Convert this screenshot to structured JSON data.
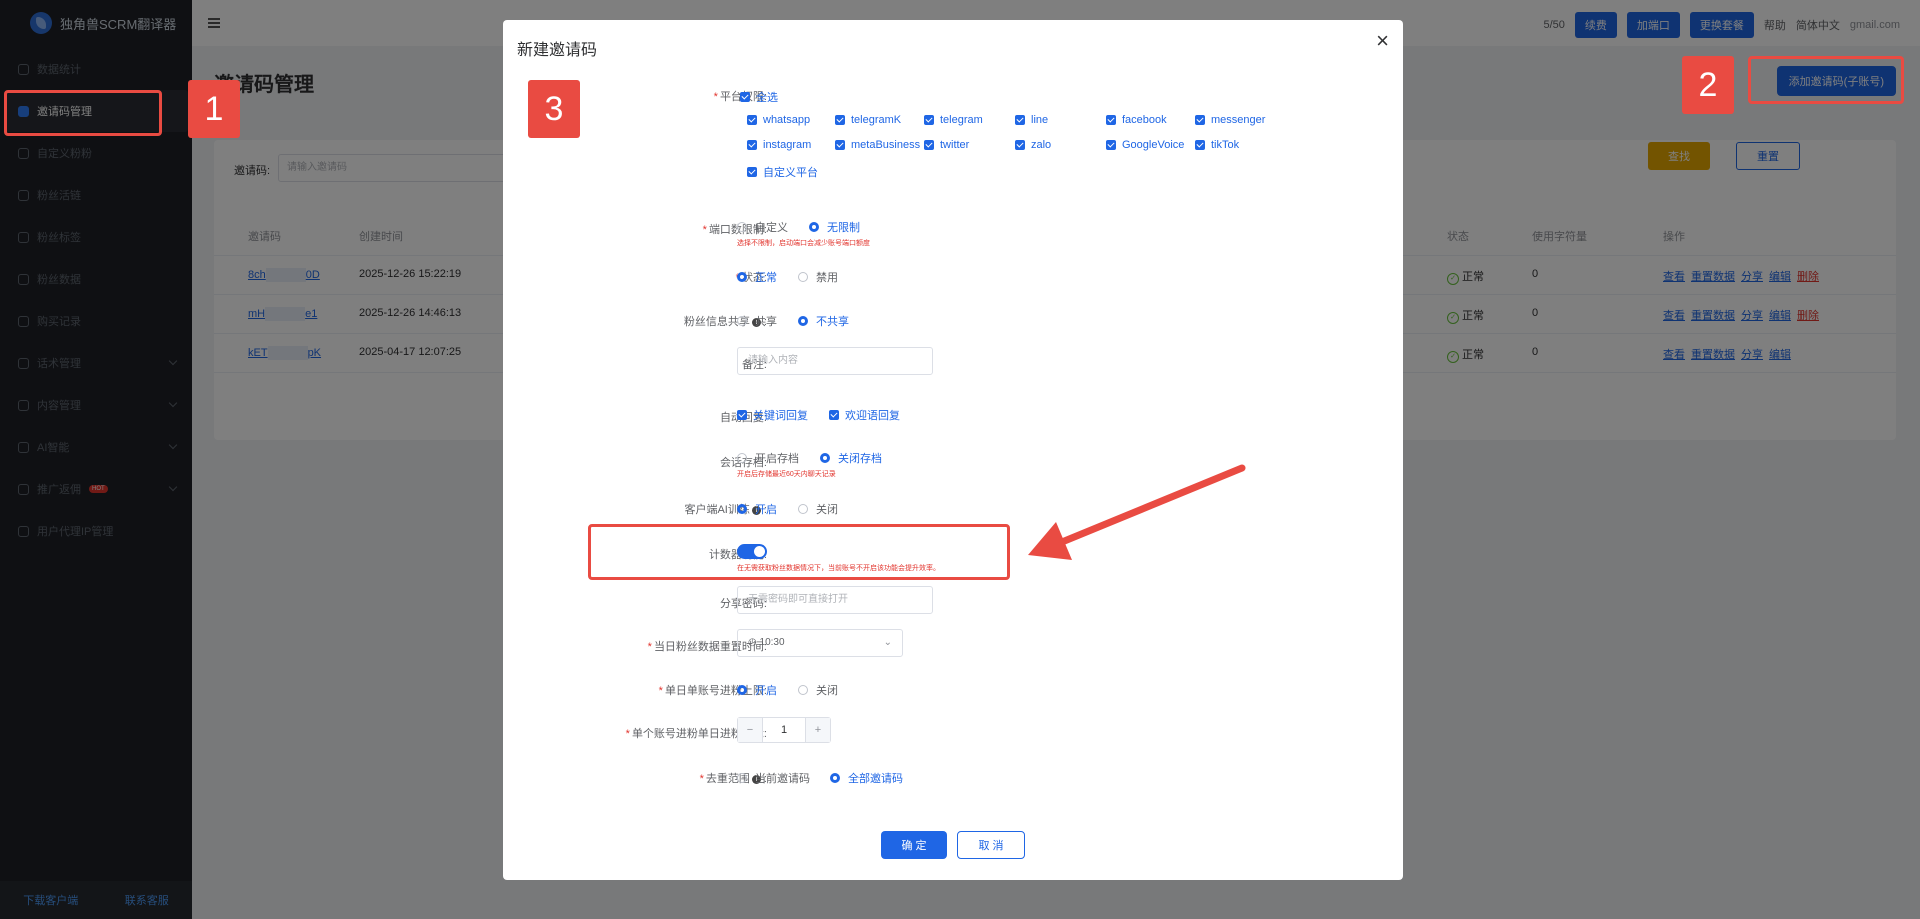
{
  "app": {
    "name": "独角兽SCRM翻译器"
  },
  "sidebar": {
    "items": [
      {
        "label": "数据统计"
      },
      {
        "label": "邀请码管理"
      },
      {
        "label": "自定义粉粉"
      },
      {
        "label": "粉丝活链"
      },
      {
        "label": "粉丝标签"
      },
      {
        "label": "粉丝数据"
      },
      {
        "label": "购买记录"
      },
      {
        "label": "话术管理"
      },
      {
        "label": "内容管理"
      },
      {
        "label": "AI智能"
      },
      {
        "label": "推广返佣",
        "badge": "HOT"
      },
      {
        "label": "用户代理IP管理"
      }
    ],
    "download": "下载客户端",
    "contact": "联系客服"
  },
  "topbar": {
    "quota": "5/50",
    "renew": "续费",
    "add_port": "加端口",
    "change_plan": "更换套餐",
    "help": "帮助",
    "language": "简体中文",
    "email": "gmail.com"
  },
  "page": {
    "title": "邀请码管理",
    "add_button": "添加邀请码(子账号)",
    "filter_label": "邀请码:",
    "filter_placeholder": "请输入邀请码",
    "search_button": "查找",
    "reset_button": "重置"
  },
  "table": {
    "headers": {
      "code": "邀请码",
      "created": "创建时间",
      "status": "状态",
      "chars": "使用字符量",
      "ops": "操作"
    },
    "rows": [
      {
        "code_a": "8ch",
        "code_b": "0D",
        "created": "2025-12-26 15:22:19",
        "status": "正常",
        "chars": "0",
        "ops": [
          "查看",
          "重置数据",
          "分享",
          "编辑",
          "删除"
        ]
      },
      {
        "code_a": "mH",
        "code_b": "e1",
        "created": "2025-12-26 14:46:13",
        "status": "正常",
        "chars": "0",
        "ops": [
          "查看",
          "重置数据",
          "分享",
          "编辑",
          "删除"
        ]
      },
      {
        "code_a": "kET",
        "code_b": "pK",
        "created": "2025-04-17 12:07:25",
        "status": "正常",
        "chars": "0",
        "ops": [
          "查看",
          "重置数据",
          "分享",
          "编辑"
        ]
      }
    ]
  },
  "modal": {
    "title": "新建邀请码",
    "platform": {
      "label": "平台权限:",
      "select_all": "全选",
      "options": [
        "whatsapp",
        "telegramK",
        "telegram",
        "line",
        "facebook",
        "messenger",
        "instagram",
        "metaBusiness",
        "twitter",
        "zalo",
        "GoogleVoice",
        "tikTok",
        "自定义平台"
      ]
    },
    "port_limit": {
      "label": "端口数限制:",
      "opt1": "自定义",
      "opt2": "无限制",
      "hint": "选择不限制，启动端口会减少账号端口额度"
    },
    "status": {
      "label": "状态:",
      "opt1": "正常",
      "opt2": "禁用"
    },
    "share_info": {
      "label": "粉丝信息共享",
      "opt1": "共享",
      "opt2": "不共享"
    },
    "remark": {
      "label": "备注:",
      "placeholder": "请输入内容"
    },
    "auto_reply": {
      "label": "自动回复:",
      "opt1": "关键词回复",
      "opt2": "欢迎语回复"
    },
    "archive": {
      "label": "会话存档:",
      "opt1": "开启存档",
      "opt2": "关闭存档",
      "hint": "开启后存储最近60天内聊天记录"
    },
    "ai_train": {
      "label": "客户端AI训练",
      "opt1": "开启",
      "opt2": "关闭"
    },
    "counter": {
      "label": "计数器功能:",
      "hint": "在无需获取粉丝数据情况下，当前账号不开启该功能会提升效率。"
    },
    "share_pwd": {
      "label": "分享密码:",
      "placeholder": "无需密码即可直接打开"
    },
    "reset_time": {
      "label": "当日粉丝数据重置时间:",
      "value": "10:30"
    },
    "daily_limit": {
      "label": "单日单账号进粉上限:",
      "opt1": "开启",
      "opt2": "关闭"
    },
    "daily_target": {
      "label": "单个账号进粉单日进粉目标:",
      "value": "1",
      "minus": "−",
      "plus": "+"
    },
    "dedup": {
      "label": "去重范围",
      "opt1": "当前邀请码",
      "opt2": "全部邀请码"
    },
    "confirm": "确 定",
    "cancel": "取 消",
    "close": "×"
  },
  "annotations": {
    "n1": "1",
    "n2": "2",
    "n3": "3",
    "color": "#e94b42"
  }
}
